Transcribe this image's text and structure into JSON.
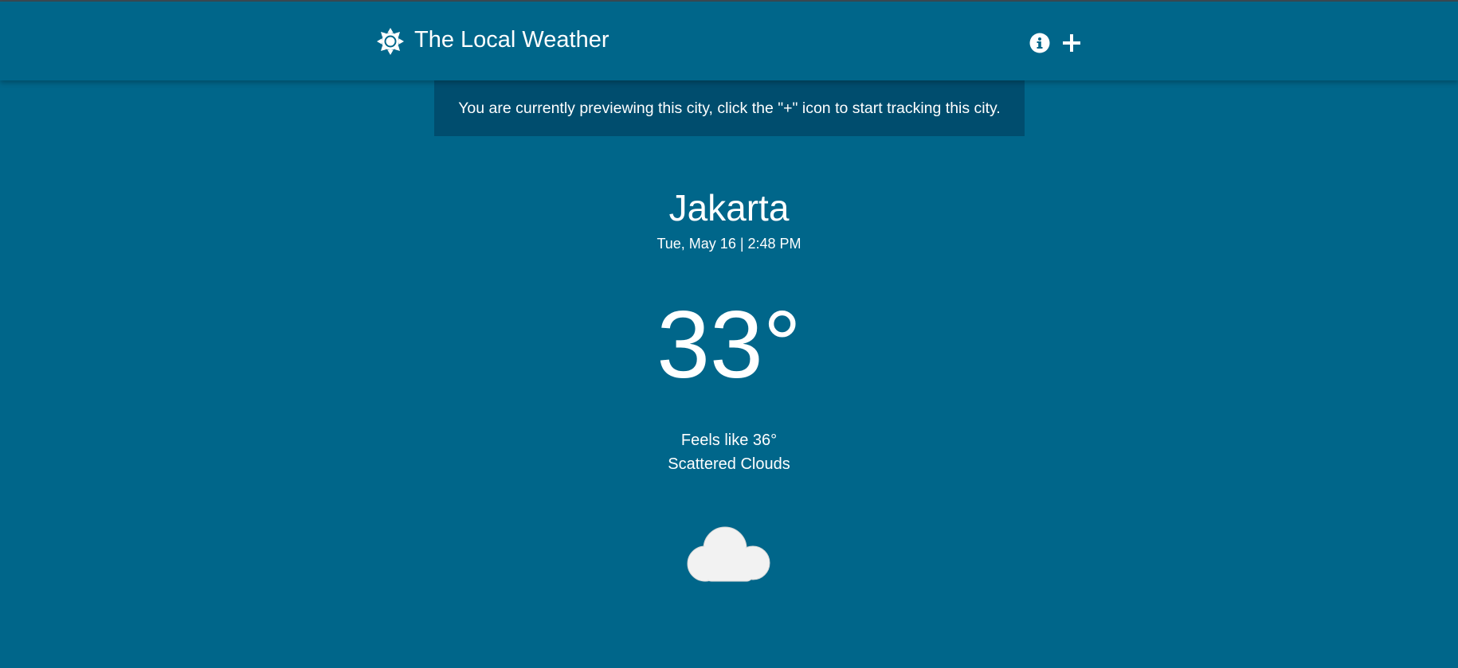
{
  "header": {
    "title": "The Local Weather",
    "logo_icon": "sun-icon",
    "actions": [
      {
        "name": "info-icon",
        "label": "i"
      },
      {
        "name": "add-icon",
        "label": "+"
      }
    ]
  },
  "banner": {
    "text": "You are currently previewing this city, click the \"+\" icon to start tracking this city."
  },
  "weather": {
    "city": "Jakarta",
    "datetime": "Tue, May 16 | 2:48 PM",
    "temperature": "33°",
    "feels_like": "Feels like 36°",
    "condition": "Scattered Clouds",
    "condition_icon": "cloud-icon"
  },
  "colors": {
    "background": "#00668a",
    "banner": "#004d6e",
    "text": "#ffffff",
    "cloud": "#f2f2f2"
  }
}
